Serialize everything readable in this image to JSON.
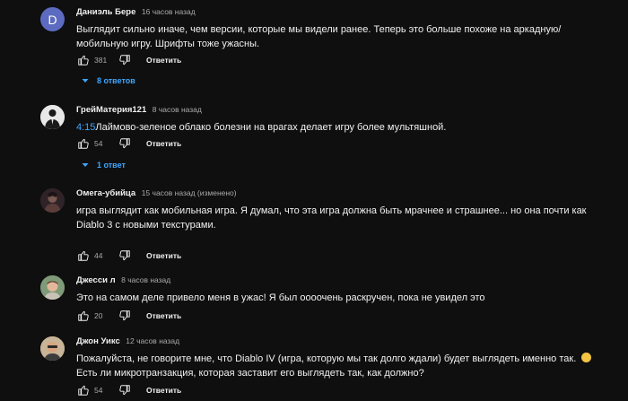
{
  "colors": {
    "background": "#0f0f0f",
    "accent": "#3ea6ff",
    "muted": "#aaaaaa"
  },
  "comments": [
    {
      "author": "Даниэль Бере",
      "time": "16 часов назад",
      "avatar_letter": "D",
      "text": "Выглядит сильно иначе, чем версии, которые мы видели ранее. Теперь это больше похоже на аркадную/мобильную игру. Шрифты тоже ужасны.",
      "likes": "381",
      "reply_label": "Ответить",
      "replies_label": "8 ответов"
    },
    {
      "author": "ГрейМатерия121",
      "time": "8 часов назад",
      "timestamp_link": "4:15",
      "text": "Лаймово-зеленое облако болезни на врагах делает игру более мультяшной.",
      "likes": "54",
      "reply_label": "Ответить",
      "replies_label": "1 ответ"
    },
    {
      "author": "Омега-убийца",
      "time": "15 часов назад (изменено)",
      "text": "игра выглядит как мобильная игра. Я думал, что эта игра должна быть мрачнее и страшнее... но она почти как Diablo 3 с новыми текстурами.",
      "likes": "44",
      "reply_label": "Ответить"
    },
    {
      "author": "Джесси л",
      "time": "8 часов назад",
      "text": "Это на самом деле привело меня в ужас! Я был оооочень раскручен, пока не увидел это",
      "likes": "20",
      "reply_label": "Ответить"
    },
    {
      "author": "Джон Уикс",
      "time": "12 часов назад",
      "text_part1": "Пожалуйста, не говорите мне, что Diablo IV (игра, которую мы так долго ждали) будет выглядеть именно так.",
      "text_part2": "Есть ли микротранзакция, которая заставит его выглядеть так, как должно?",
      "emoji": "worried-face",
      "likes": "54",
      "reply_label": "Ответить"
    }
  ]
}
